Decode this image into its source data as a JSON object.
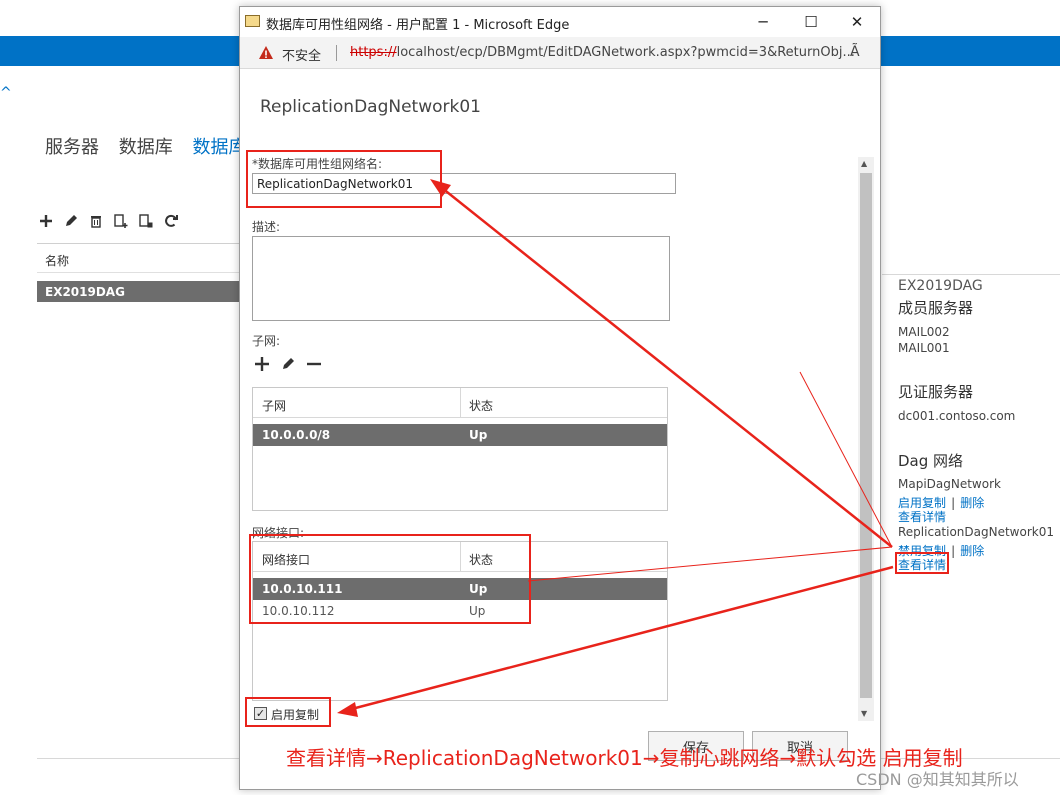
{
  "background": {
    "tabs": [
      {
        "label": "服务器",
        "active": false
      },
      {
        "label": "数据库",
        "active": false
      },
      {
        "label": "数据库",
        "active": true
      }
    ],
    "list": {
      "header": "名称",
      "rows": [
        "EX2019DAG"
      ]
    },
    "toolbar_icons": [
      "add-icon",
      "edit-icon",
      "delete-icon",
      "add-member-icon",
      "remove-member-icon",
      "refresh-icon"
    ]
  },
  "details": {
    "dag_name": "EX2019DAG",
    "member_heading": "成员服务器",
    "members": [
      "MAIL002",
      "MAIL001"
    ],
    "witness_heading": "见证服务器",
    "witness": "dc001.contoso.com",
    "network_heading": "Dag 网络",
    "networks": [
      {
        "name": "MapiDagNetwork",
        "toggle": "启用复制",
        "sep": "|",
        "delete": "删除",
        "view": "查看详情"
      },
      {
        "name": "ReplicationDagNetwork01",
        "toggle": "禁用复制",
        "sep": "|",
        "delete": "删除",
        "view": "查看详情"
      }
    ]
  },
  "window": {
    "title": "数据库可用性组网络 - 用户配置 1 - Microsoft Edge",
    "minimize": "─",
    "maximize": "☐",
    "close": "✕",
    "insecure_label": "不安全",
    "url_scheme": "https://",
    "url_rest": "localhost/ecp/DBMgmt/EditDAGNetwork.aspx?pwmcid=3&ReturnObj...",
    "read_aloud": "Ã"
  },
  "form": {
    "page_title": "ReplicationDagNetwork01",
    "name_label": "*数据库可用性组网络名:",
    "name_value": "ReplicationDagNetwork01",
    "description_label": "描述:",
    "subnet_label": "子网:",
    "subnet_grid": {
      "headers": [
        "子网",
        "状态"
      ],
      "rows": [
        {
          "subnet": "10.0.0.0/8",
          "status": "Up",
          "selected": true
        }
      ]
    },
    "interface_label": "网络接口:",
    "interface_grid": {
      "headers": [
        "网络接口",
        "状态"
      ],
      "rows": [
        {
          "ip": "10.0.10.111",
          "status": "Up",
          "selected": true
        },
        {
          "ip": "10.0.10.112",
          "status": "Up",
          "selected": false
        }
      ]
    },
    "replication_checkbox": {
      "label": "启用复制",
      "checked": true
    },
    "save_label": "保存",
    "cancel_label": "取消"
  },
  "annotation": {
    "caption": "查看详情→ReplicationDagNetwork01→复制心跳网络→默认勾选 启用复制",
    "color": "#e8231b"
  },
  "watermark": "CSDN @知其知其所以"
}
